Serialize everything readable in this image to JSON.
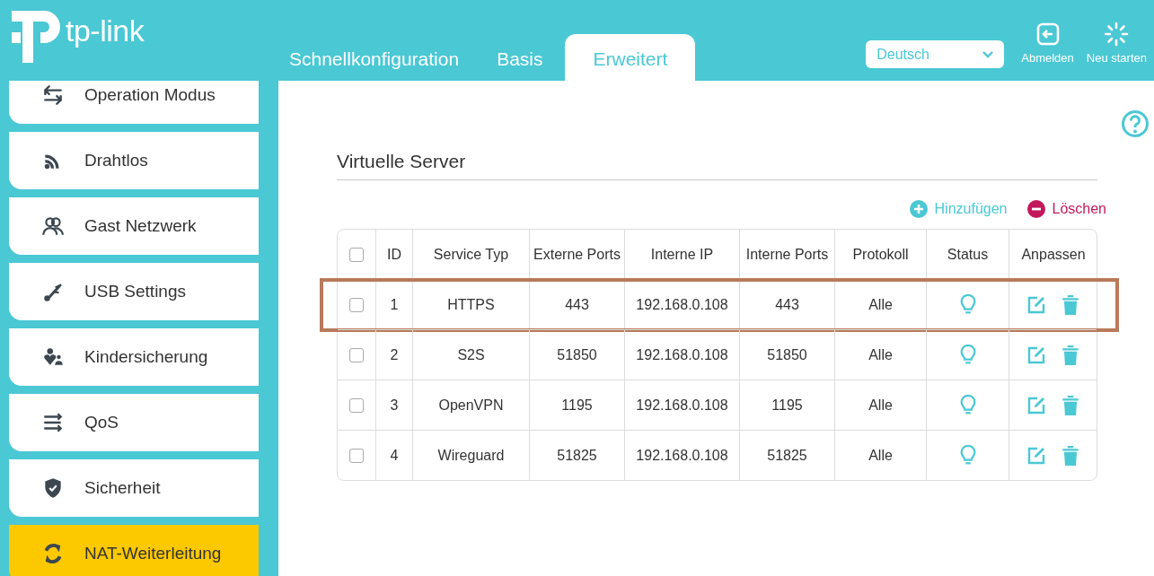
{
  "logo": {
    "text": "tp-link"
  },
  "nav_tabs": [
    {
      "label": "Schnellkonfiguration",
      "selected": false
    },
    {
      "label": "Basis",
      "selected": false
    },
    {
      "label": "Erweitert",
      "selected": true
    }
  ],
  "language": {
    "value": "Deutsch"
  },
  "header_actions": [
    {
      "kind": "logout",
      "label": "Abmelden"
    },
    {
      "kind": "reboot",
      "label": "Neu starten"
    }
  ],
  "sidebar": {
    "items": [
      {
        "kind": "mode",
        "label": "Operation Modus",
        "selected": false
      },
      {
        "kind": "wireless",
        "label": "Drahtlos",
        "selected": false
      },
      {
        "kind": "guest",
        "label": "Gast Netzwerk",
        "selected": false
      },
      {
        "kind": "usb",
        "label": "USB Settings",
        "selected": false
      },
      {
        "kind": "parental",
        "label": "Kindersicherung",
        "selected": false
      },
      {
        "kind": "qos",
        "label": "QoS",
        "selected": false
      },
      {
        "kind": "security",
        "label": "Sicherheit",
        "selected": false
      },
      {
        "kind": "nat",
        "label": "NAT-Weiterleitung",
        "selected": true
      }
    ]
  },
  "section": {
    "title": "Virtuelle Server",
    "add_label": "Hinzufügen",
    "delete_label": "Löschen"
  },
  "table": {
    "header_checked": false,
    "columns": [
      "ID",
      "Service Typ",
      "Externe Ports",
      "Interne IP",
      "Interne Ports",
      "Protokoll",
      "Status",
      "Anpassen"
    ],
    "rows": [
      {
        "checked": false,
        "highlighted": true,
        "enabled": true,
        "cells": [
          "1",
          "HTTPS",
          "443",
          "192.168.0.108",
          "443",
          "Alle"
        ]
      },
      {
        "checked": false,
        "highlighted": false,
        "enabled": true,
        "cells": [
          "2",
          "S2S",
          "51850",
          "192.168.0.108",
          "51850",
          "Alle"
        ]
      },
      {
        "checked": false,
        "highlighted": false,
        "enabled": true,
        "cells": [
          "3",
          "OpenVPN",
          "1195",
          "192.168.0.108",
          "1195",
          "Alle"
        ]
      },
      {
        "checked": false,
        "highlighted": false,
        "enabled": true,
        "cells": [
          "4",
          "Wireguard",
          "51825",
          "192.168.0.108",
          "51825",
          "Alle"
        ]
      }
    ]
  }
}
